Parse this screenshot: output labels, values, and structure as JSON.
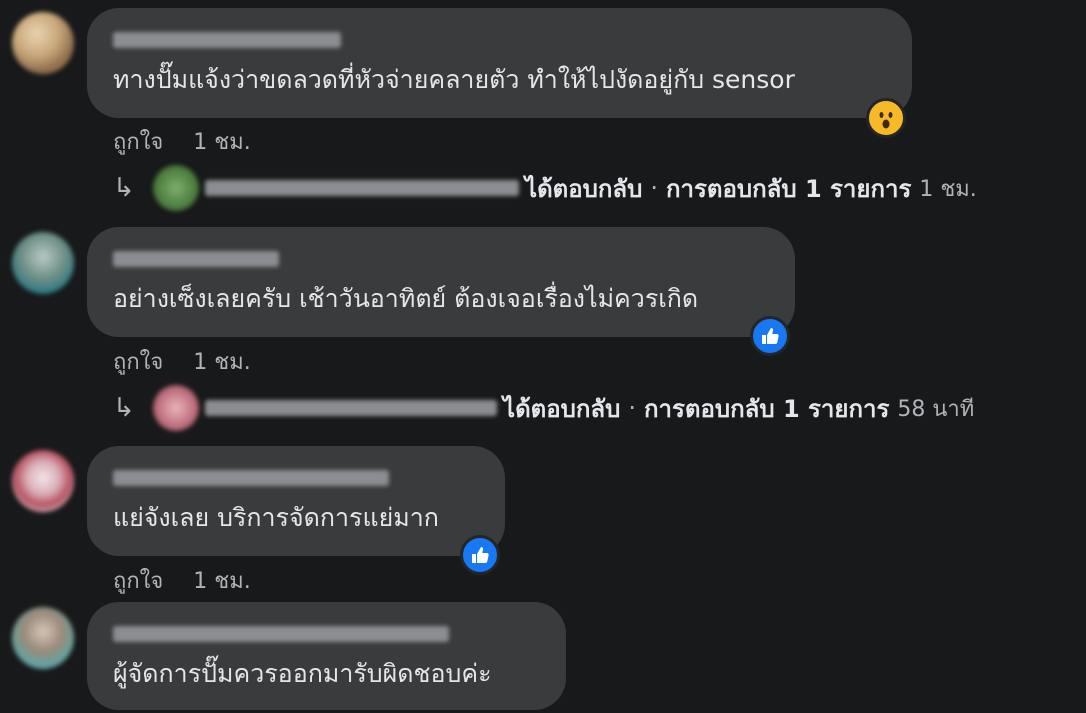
{
  "comments": [
    {
      "text": "ทางปั๊มแจ้งว่าขดลวดที่หัวจ่ายคลายตัว ทำให้ไปงัดอยู่กับ sensor",
      "like_label": "ถูกใจ",
      "time": "1 ชม.",
      "reaction": "wow-icon",
      "reply": {
        "action": "ได้ตอบกลับ",
        "separator": "·",
        "count_label": "การตอบกลับ 1 รายการ",
        "time": "1 ชม."
      }
    },
    {
      "text": "อย่างเซ็งเลยครับ เช้าวันอาทิตย์ ต้องเจอเรื่องไม่ควรเกิด",
      "like_label": "ถูกใจ",
      "time": "1 ชม.",
      "reaction": "like-icon",
      "reply": {
        "action": "ได้ตอบกลับ",
        "separator": "·",
        "count_label": "การตอบกลับ 1 รายการ",
        "time": "58 นาที"
      }
    },
    {
      "text": "แย่จังเลย บริการจัดการแย่มาก",
      "like_label": "ถูกใจ",
      "time": "1 ชม.",
      "reaction": "like-icon"
    },
    {
      "text": "ผู้จัดการปั๊มควรออกมารับผิดชอบค่ะ"
    }
  ],
  "colors": {
    "background": "#18191a",
    "bubble": "#3a3b3c",
    "text": "#e4e6eb",
    "secondary_text": "#b0b3b8",
    "like_blue": "#1877f2",
    "wow_yellow": "#f7b928"
  }
}
